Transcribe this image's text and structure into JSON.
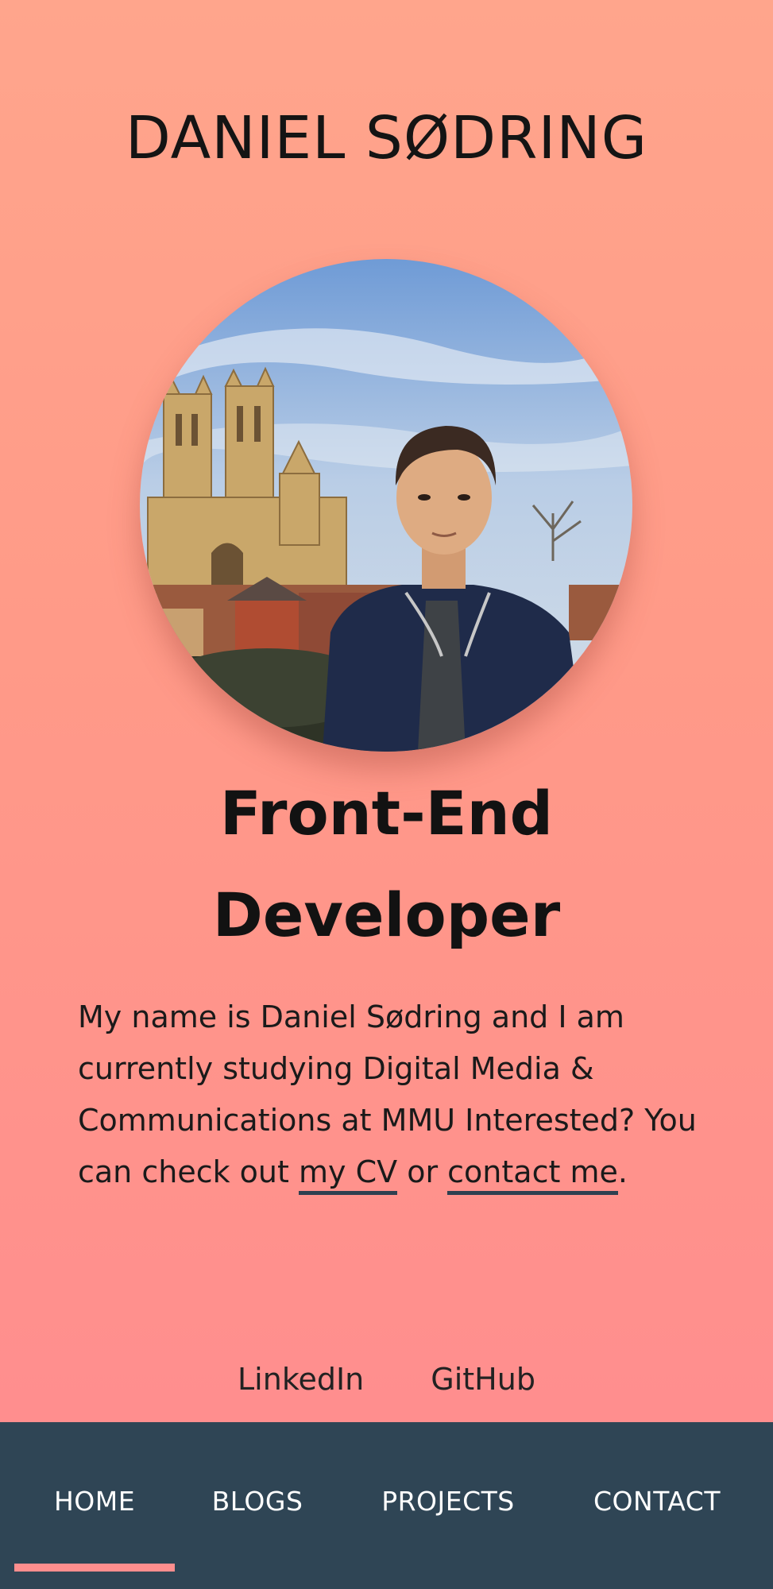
{
  "header": {
    "site_name": "DANIEL SØDRING"
  },
  "profile": {
    "avatar_alt": "Daniel Sødring in front of Lincoln Cathedral"
  },
  "hero": {
    "title_line1": "Front-End",
    "title_line2": "Developer"
  },
  "intro": {
    "text_before": "My name is Daniel Sødring and I am currently studying Digital Media & Communications at MMU Interested? You can check out ",
    "cv_link": "my CV",
    "text_middle": " or ",
    "contact_link": "contact me",
    "text_end": "."
  },
  "social": {
    "linkedin": "LinkedIn",
    "github": "GitHub"
  },
  "nav": {
    "items": [
      {
        "label": "HOME",
        "active": true
      },
      {
        "label": "BLOGS",
        "active": false
      },
      {
        "label": "PROJECTS",
        "active": false
      },
      {
        "label": "CONTACT",
        "active": false
      }
    ]
  },
  "colors": {
    "background_top": "#ffa58c",
    "background_bottom": "#ff8e8e",
    "navbar": "#2f4555",
    "accent": "#ff8e8e",
    "link_underline": "#2e4050"
  }
}
